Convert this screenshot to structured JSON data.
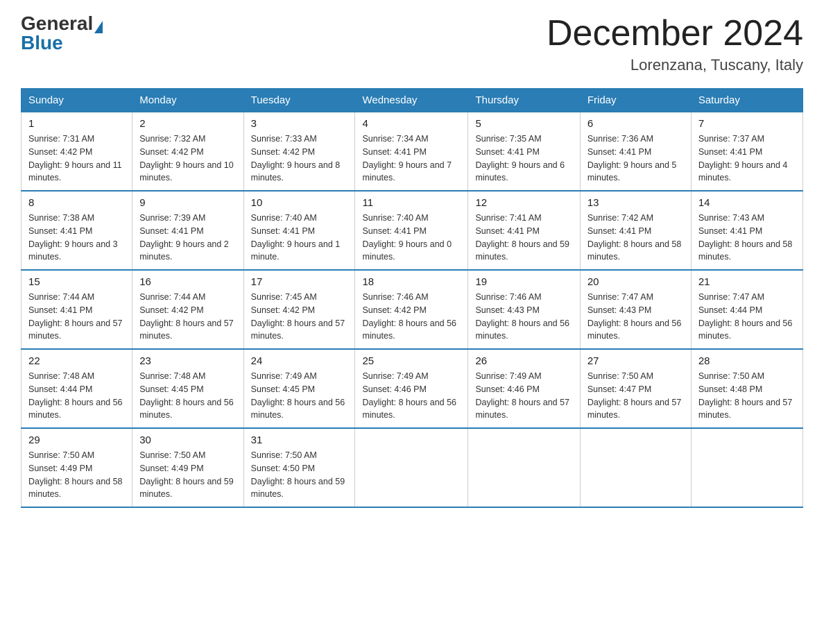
{
  "header": {
    "logo_general": "General",
    "logo_blue": "Blue",
    "title": "December 2024",
    "subtitle": "Lorenzana, Tuscany, Italy"
  },
  "days_of_week": [
    "Sunday",
    "Monday",
    "Tuesday",
    "Wednesday",
    "Thursday",
    "Friday",
    "Saturday"
  ],
  "weeks": [
    [
      {
        "num": "1",
        "sunrise": "7:31 AM",
        "sunset": "4:42 PM",
        "daylight": "9 hours and 11 minutes."
      },
      {
        "num": "2",
        "sunrise": "7:32 AM",
        "sunset": "4:42 PM",
        "daylight": "9 hours and 10 minutes."
      },
      {
        "num": "3",
        "sunrise": "7:33 AM",
        "sunset": "4:42 PM",
        "daylight": "9 hours and 8 minutes."
      },
      {
        "num": "4",
        "sunrise": "7:34 AM",
        "sunset": "4:41 PM",
        "daylight": "9 hours and 7 minutes."
      },
      {
        "num": "5",
        "sunrise": "7:35 AM",
        "sunset": "4:41 PM",
        "daylight": "9 hours and 6 minutes."
      },
      {
        "num": "6",
        "sunrise": "7:36 AM",
        "sunset": "4:41 PM",
        "daylight": "9 hours and 5 minutes."
      },
      {
        "num": "7",
        "sunrise": "7:37 AM",
        "sunset": "4:41 PM",
        "daylight": "9 hours and 4 minutes."
      }
    ],
    [
      {
        "num": "8",
        "sunrise": "7:38 AM",
        "sunset": "4:41 PM",
        "daylight": "9 hours and 3 minutes."
      },
      {
        "num": "9",
        "sunrise": "7:39 AM",
        "sunset": "4:41 PM",
        "daylight": "9 hours and 2 minutes."
      },
      {
        "num": "10",
        "sunrise": "7:40 AM",
        "sunset": "4:41 PM",
        "daylight": "9 hours and 1 minute."
      },
      {
        "num": "11",
        "sunrise": "7:40 AM",
        "sunset": "4:41 PM",
        "daylight": "9 hours and 0 minutes."
      },
      {
        "num": "12",
        "sunrise": "7:41 AM",
        "sunset": "4:41 PM",
        "daylight": "8 hours and 59 minutes."
      },
      {
        "num": "13",
        "sunrise": "7:42 AM",
        "sunset": "4:41 PM",
        "daylight": "8 hours and 58 minutes."
      },
      {
        "num": "14",
        "sunrise": "7:43 AM",
        "sunset": "4:41 PM",
        "daylight": "8 hours and 58 minutes."
      }
    ],
    [
      {
        "num": "15",
        "sunrise": "7:44 AM",
        "sunset": "4:41 PM",
        "daylight": "8 hours and 57 minutes."
      },
      {
        "num": "16",
        "sunrise": "7:44 AM",
        "sunset": "4:42 PM",
        "daylight": "8 hours and 57 minutes."
      },
      {
        "num": "17",
        "sunrise": "7:45 AM",
        "sunset": "4:42 PM",
        "daylight": "8 hours and 57 minutes."
      },
      {
        "num": "18",
        "sunrise": "7:46 AM",
        "sunset": "4:42 PM",
        "daylight": "8 hours and 56 minutes."
      },
      {
        "num": "19",
        "sunrise": "7:46 AM",
        "sunset": "4:43 PM",
        "daylight": "8 hours and 56 minutes."
      },
      {
        "num": "20",
        "sunrise": "7:47 AM",
        "sunset": "4:43 PM",
        "daylight": "8 hours and 56 minutes."
      },
      {
        "num": "21",
        "sunrise": "7:47 AM",
        "sunset": "4:44 PM",
        "daylight": "8 hours and 56 minutes."
      }
    ],
    [
      {
        "num": "22",
        "sunrise": "7:48 AM",
        "sunset": "4:44 PM",
        "daylight": "8 hours and 56 minutes."
      },
      {
        "num": "23",
        "sunrise": "7:48 AM",
        "sunset": "4:45 PM",
        "daylight": "8 hours and 56 minutes."
      },
      {
        "num": "24",
        "sunrise": "7:49 AM",
        "sunset": "4:45 PM",
        "daylight": "8 hours and 56 minutes."
      },
      {
        "num": "25",
        "sunrise": "7:49 AM",
        "sunset": "4:46 PM",
        "daylight": "8 hours and 56 minutes."
      },
      {
        "num": "26",
        "sunrise": "7:49 AM",
        "sunset": "4:46 PM",
        "daylight": "8 hours and 57 minutes."
      },
      {
        "num": "27",
        "sunrise": "7:50 AM",
        "sunset": "4:47 PM",
        "daylight": "8 hours and 57 minutes."
      },
      {
        "num": "28",
        "sunrise": "7:50 AM",
        "sunset": "4:48 PM",
        "daylight": "8 hours and 57 minutes."
      }
    ],
    [
      {
        "num": "29",
        "sunrise": "7:50 AM",
        "sunset": "4:49 PM",
        "daylight": "8 hours and 58 minutes."
      },
      {
        "num": "30",
        "sunrise": "7:50 AM",
        "sunset": "4:49 PM",
        "daylight": "8 hours and 59 minutes."
      },
      {
        "num": "31",
        "sunrise": "7:50 AM",
        "sunset": "4:50 PM",
        "daylight": "8 hours and 59 minutes."
      },
      null,
      null,
      null,
      null
    ]
  ]
}
